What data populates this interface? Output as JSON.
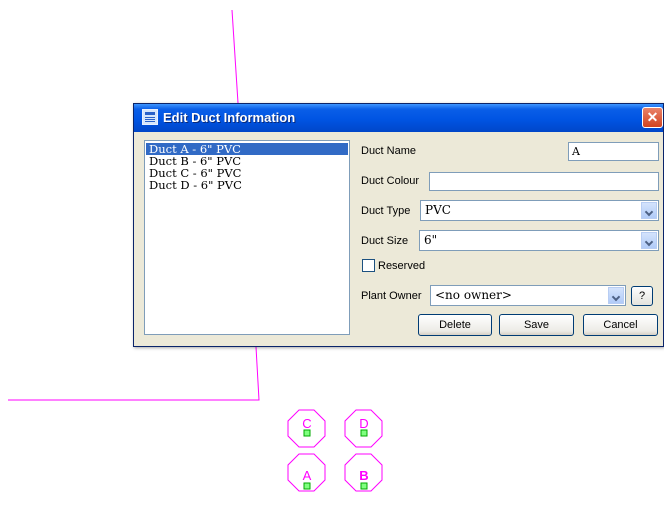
{
  "dialog": {
    "title": "Edit Duct Information",
    "close_glyph": "✕",
    "ducts": [
      "Duct A - 6\" PVC",
      "Duct B - 6\" PVC",
      "Duct C - 6\" PVC",
      "Duct D - 6\" PVC"
    ],
    "selected_duct_index": 0,
    "fields": {
      "name_label": "Duct Name",
      "name_value": "A",
      "colour_label": "Duct Colour",
      "colour_value": "",
      "type_label": "Duct Type",
      "type_value": "PVC",
      "size_label": "Duct Size",
      "size_value": "6\"",
      "reserved_label": "Reserved",
      "reserved_checked": false,
      "owner_label": "Plant Owner",
      "owner_value": "<no owner>",
      "help_label": "?"
    },
    "buttons": {
      "delete": "Delete",
      "save": "Save",
      "cancel": "Cancel"
    }
  },
  "drawing": {
    "line_color": "#ff00ff",
    "marker_color": "#00cc00",
    "duct_labels": [
      "C",
      "D",
      "A",
      "B"
    ]
  }
}
